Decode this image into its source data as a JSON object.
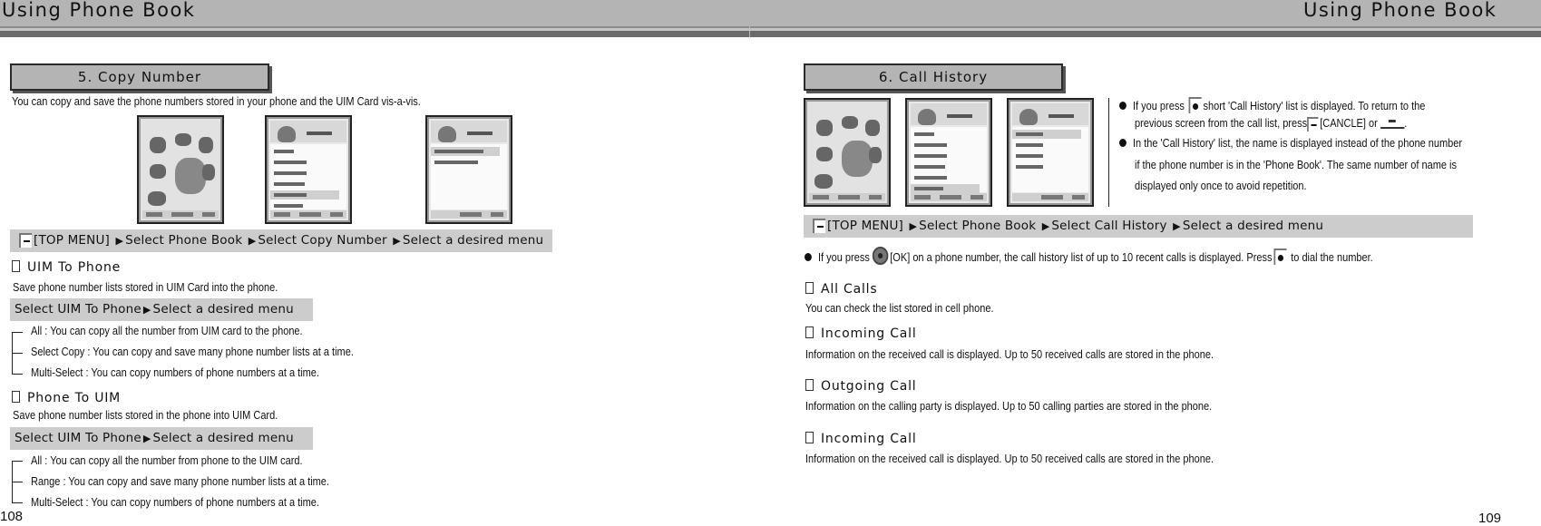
{
  "header": {
    "left_title": "Using Phone Book",
    "right_title": "Using Phone Book"
  },
  "left_page": {
    "section_title": "5. Copy Number",
    "intro": "You can copy and save the phone numbers stored in your phone and the UIM Card vis-a-vis.",
    "screenshots": [
      "phone-main-menu",
      "phone-book-menu",
      "copy-number-menu"
    ],
    "path": {
      "items": [
        "[TOP MENU]",
        "Select Phone Book",
        "Select Copy Number",
        "Select a desired menu"
      ]
    },
    "subsections": [
      {
        "title": "UIM To Phone",
        "description": "Save phone number lists stored in UIM Card into the phone.",
        "path": [
          "Select UIM To Phone",
          "Select a desired menu"
        ],
        "options": [
          "All : You can copy all the number from UIM card to the phone.",
          "Select Copy : You can copy and save many phone number lists at a time.",
          "Multi-Select : You can copy numbers of phone numbers at a time."
        ]
      },
      {
        "title": "Phone To UIM",
        "description": "Save phone number lists stored in the phone into UIM Card.",
        "path": [
          "Select UIM To Phone",
          "Select a desired menu"
        ],
        "options": [
          "All : You can copy all the number from phone to the UIM card.",
          "Range : You can copy and save many phone number lists at a time.",
          "Multi-Select : You can copy numbers of phone numbers at a time."
        ]
      }
    ],
    "page_number": "108"
  },
  "right_page": {
    "section_title": "6. Call History",
    "screenshots": [
      "phone-main-menu",
      "phone-book-menu",
      "call-history-menu"
    ],
    "notes": {
      "note1_a": "If you press",
      "note1_b": "short 'Call History' list is displayed. To return to the",
      "note1_c": "previous screen from the call list, press",
      "note1_d": "[CANCLE] or",
      "note1_e": ".",
      "note2_a": "In the 'Call History' list, the name is displayed instead of the phone number",
      "note2_b": "if the phone number is in the 'Phone Book'. The same number of name is",
      "note2_c": "displayed only once to avoid repetition."
    },
    "path": {
      "items": [
        "[TOP MENU]",
        "Select Phone Book",
        "Select Call History",
        "Select a desired menu"
      ]
    },
    "ok_note": {
      "a": "If you press",
      "b": "[OK] on a phone number, the call history list of up to 10 recent calls is displayed. Press",
      "c": "to dial the number."
    },
    "subsections": [
      {
        "title": "All Calls",
        "description": "You can check the list stored in cell phone."
      },
      {
        "title": "Incoming Call",
        "description": "Information on the received call is displayed. Up to 50 received calls are stored in the phone."
      },
      {
        "title": "Outgoing Call",
        "description": "Information on the calling party is displayed. Up to 50 calling parties are stored in the phone."
      },
      {
        "title": "Incoming Call",
        "description": "Information on the received call is displayed. Up to 50 received calls are stored in the phone."
      }
    ],
    "page_number": "109"
  }
}
